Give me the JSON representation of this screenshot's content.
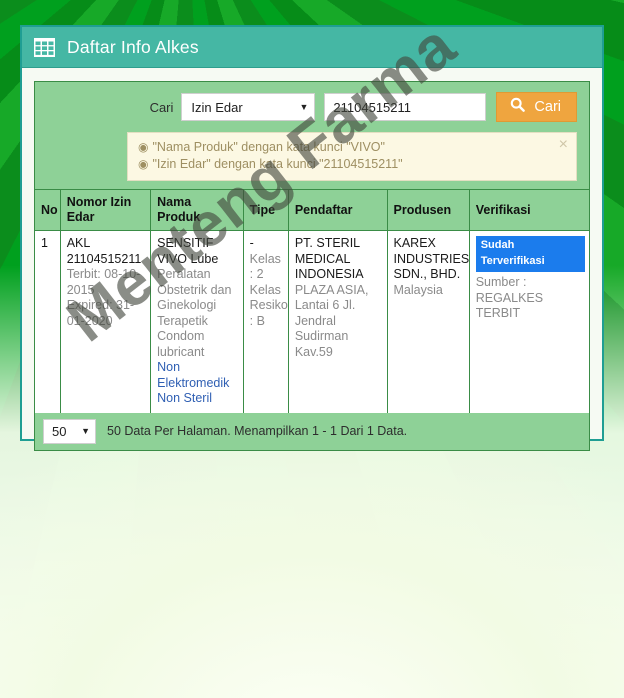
{
  "page": {
    "watermark": "Menteng Farma",
    "background_color": "#0a9a1e",
    "accent_color": "#45b7a4"
  },
  "panel": {
    "title": "Daftar Info Alkes",
    "title_icon": "table-grid-icon",
    "title_bg": "#45b7a4"
  },
  "search": {
    "label": "Cari",
    "field_select": {
      "value": "Izin Edar",
      "caret_icon": "chevron-down-icon"
    },
    "keyword": {
      "value": "21104515211",
      "placeholder": ""
    },
    "button": {
      "label": "Cari",
      "icon": "search-icon",
      "color": "#efa53f"
    }
  },
  "alert": {
    "lines": [
      "\"Nama Produk\" dengan kata kunci \"VIVO\"",
      "\"Izin Edar\" dengan kata kunci \"21104515211\""
    ],
    "bullet_icon": "circle-dot-icon",
    "close_icon": "close-icon",
    "close_label": "×",
    "bg": "#fcf8e3"
  },
  "table": {
    "columns": [
      "No",
      "Nomor Izin Edar",
      "Nama Produk",
      "Tipe",
      "Pendaftar",
      "Produsen",
      "Verifikasi"
    ],
    "rows": [
      {
        "no": "1",
        "izin_edar": {
          "code": "AKL 21104515211",
          "terbit": "Terbit: 08-10-2015",
          "expired": "Expired: 31-01-2020"
        },
        "nama_produk": {
          "name": "SENSITIF VIVO Lube",
          "kategori": "Peralatan Obstetrik dan Ginekologi Terapetik",
          "sub": "Condom lubricant",
          "elektro": "Non Elektromedik",
          "steril": "Non Steril"
        },
        "tipe": {
          "dash": "-",
          "kelas": "Kelas : 2",
          "kelas_resiko": "Kelas Resiko : B"
        },
        "pendaftar": {
          "name": "PT. STERIL MEDICAL INDONESIA",
          "address": "PLAZA ASIA, Lantai 6 Jl. Jendral Sudirman Kav.59"
        },
        "produsen": {
          "name": "KAREX INDUSTRIES SDN., BHD.",
          "country": "Malaysia"
        },
        "verifikasi": {
          "badge": "Sudah Terverifikasi",
          "badge_color": "#1b7ced",
          "sumber_label": "Sumber :",
          "sumber_value": "REGALKES TERBIT"
        }
      }
    ]
  },
  "footer": {
    "per_page": {
      "value": "50",
      "caret_icon": "chevron-down-icon"
    },
    "info": "50 Data Per Halaman. Menampilkan 1 - 1 Dari 1 Data."
  }
}
